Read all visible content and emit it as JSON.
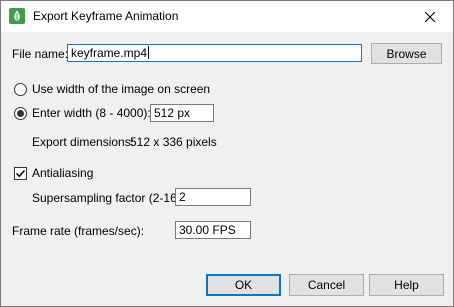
{
  "window": {
    "title": "Export Keyframe Animation",
    "icon": "leaf-icon",
    "close_icon": "close-icon"
  },
  "form": {
    "file_name_label": "File name:",
    "file_name_value": "keyframe.mp4",
    "browse_label": "Browse",
    "option_screen_label": "Use width of the image on screen",
    "option_screen_selected": false,
    "option_width_label": "Enter width (8 - 4000):",
    "option_width_selected": true,
    "width_value": "512 px",
    "export_dimensions_label": "Export dimensions:",
    "export_dimensions_value": "512 x 336 pixels",
    "antialiasing_label": "Antialiasing",
    "antialiasing_checked": true,
    "supersampling_label": "Supersampling factor (2-16):",
    "supersampling_value": "2",
    "frame_rate_label": "Frame rate (frames/sec):",
    "frame_rate_value": "30.00 FPS"
  },
  "buttons": {
    "ok": "OK",
    "cancel": "Cancel",
    "help": "Help"
  },
  "colors": {
    "accent": "#0078d7",
    "icon_green": "#3aa048"
  }
}
